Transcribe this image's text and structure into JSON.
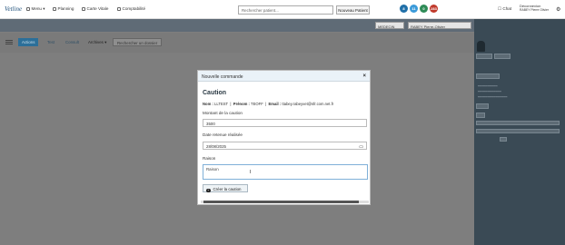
{
  "navbar": {
    "logo": "Vetline",
    "menu": "Menu",
    "planning": "Planning",
    "carte_vitale": "Carte Vitale",
    "comptabilite": "Comptabilité",
    "search_placeholder": "Rechercher patient...",
    "new_patient": "Nouveau Patient",
    "badges": [
      {
        "text": "8",
        "color": "#1f6fa8"
      },
      {
        "text": "11",
        "color": "#3a9ad9"
      },
      {
        "text": "0",
        "color": "#2e8b57"
      },
      {
        "text": "283",
        "color": "#c0392b"
      }
    ],
    "chat": "Chat",
    "user_line1": "Déconnexion",
    "user_line2": "RABEY Pierre Olivier",
    "accent": "#1d4f7a"
  },
  "background": {
    "select1": "MEDECIN",
    "select2": "RABEY Pierre-Olivier",
    "btn_active": "Actions",
    "btn_text1": "Test",
    "btn_text2": "Consult",
    "btn_archive": "Archives",
    "btn_rechercher": "Rechercher un dossier"
  },
  "modal": {
    "title": "Nouvelle commande",
    "close": "×",
    "heading": "Caution",
    "nom_label": "Nom :",
    "nom_value": "LLTEST",
    "prenom_label": "Prénom :",
    "prenom_value": "TEOFF",
    "email_label": "Email :",
    "email_value": "ttabey.rabeyvet@sfr.com.net.fr",
    "montant_label": "Montant de la caution",
    "montant_value": "3500",
    "date_label": "Date retenue réalisée",
    "date_value": "28/08/2025",
    "raison_label": "Raison",
    "raison_value": "Raison",
    "create_button": "Créer la caution"
  }
}
